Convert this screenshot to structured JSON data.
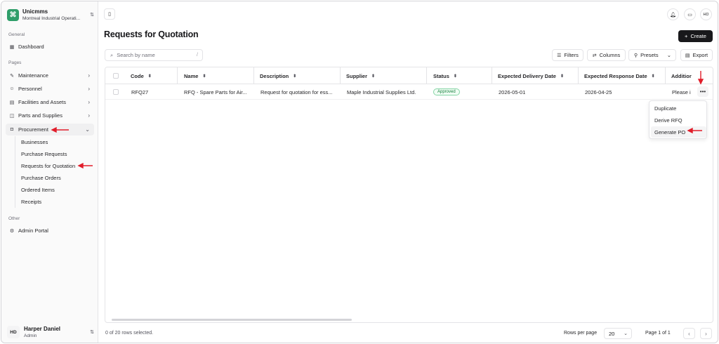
{
  "org": {
    "name": "Unicmms",
    "subtitle": "Montreal Industrial Operati..."
  },
  "sidebar": {
    "general_label": "General",
    "dashboard": "Dashboard",
    "pages_label": "Pages",
    "items": [
      {
        "label": "Maintenance",
        "icon": "wrench-icon"
      },
      {
        "label": "Personnel",
        "icon": "users-icon"
      },
      {
        "label": "Facilities and Assets",
        "icon": "building-icon"
      },
      {
        "label": "Parts and Supplies",
        "icon": "package-icon"
      },
      {
        "label": "Procurement",
        "icon": "bag-icon"
      }
    ],
    "procurement_sub": [
      "Businesses",
      "Purchase Requests",
      "Requests for Quotation",
      "Purchase Orders",
      "Ordered Items",
      "Receipts"
    ],
    "other_label": "Other",
    "admin_portal": "Admin Portal"
  },
  "user": {
    "initials": "HD",
    "name": "Harper Daniel",
    "role": "Admin"
  },
  "header": {
    "title": "Requests for Quotation",
    "create_label": "Create",
    "user_initials": "HD"
  },
  "toolbar": {
    "search_placeholder": "Search by name",
    "search_key": "/",
    "filters": "Filters",
    "columns": "Columns",
    "presets": "Presets",
    "export": "Export"
  },
  "table": {
    "columns": [
      "Code",
      "Name",
      "Description",
      "Supplier",
      "Status",
      "Expected Delivery Date",
      "Expected Response Date",
      "Additior"
    ],
    "rows": [
      {
        "code": "RFQ27",
        "name": "RFQ - Spare Parts for Air...",
        "description": "Request for quotation for ess...",
        "supplier": "Maple Industrial Supplies Ltd.",
        "status": "Approved",
        "delivery": "2026-05-01",
        "response": "2026-04-25",
        "additional": "Please i"
      }
    ]
  },
  "row_menu": {
    "items": [
      "Duplicate",
      "Derive RFQ",
      "Generate PO"
    ]
  },
  "footer": {
    "selection": "0 of 20 rows selected.",
    "rows_per_page_label": "Rows per page",
    "rows_per_page": "20",
    "page_info": "Page 1 of 1"
  },
  "colors": {
    "accent": "#18181b",
    "brand": "#2f9e6a",
    "status_approved": "#15803d",
    "annotation_arrow": "#e11d2a"
  }
}
